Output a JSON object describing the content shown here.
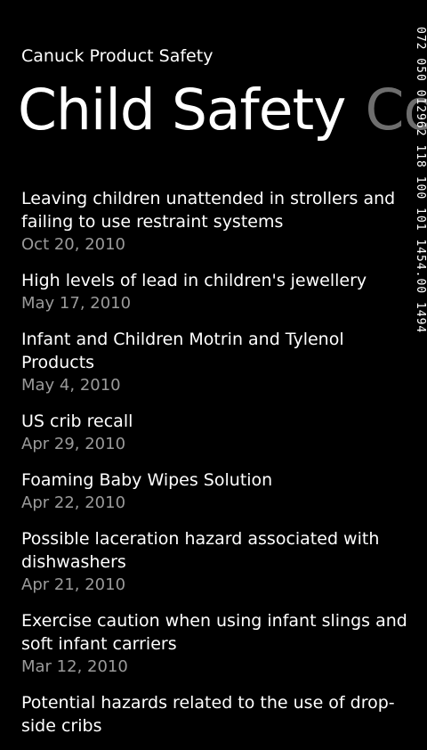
{
  "app": {
    "title": "Canuck Product Safety"
  },
  "pivot": {
    "active": "Child Safety",
    "next_peek": "Co"
  },
  "overlay_counter": "072 050 012962 118 100 101 1454.00 1494",
  "items": [
    {
      "title": "Leaving children unattended in strollers and failing to use restraint systems",
      "date": "Oct 20, 2010"
    },
    {
      "title": "High levels of lead in children's jewellery",
      "date": "May 17, 2010"
    },
    {
      "title": "Infant and Children Motrin and Tylenol Products",
      "date": "May 4, 2010"
    },
    {
      "title": "US crib recall",
      "date": "Apr 29, 2010"
    },
    {
      "title": "Foaming Baby Wipes Solution",
      "date": "Apr 22, 2010"
    },
    {
      "title": "Possible laceration hazard associated with dishwashers",
      "date": "Apr 21, 2010"
    },
    {
      "title": "Exercise caution when using infant slings and soft infant carriers",
      "date": "Mar 12, 2010"
    },
    {
      "title": "Potential hazards related to the use of drop-side cribs",
      "date": ""
    }
  ],
  "colors": {
    "background": "#000000",
    "text": "#ffffff",
    "subtle": "#9a9a9a",
    "inactive_pivot": "#6e6e6e"
  }
}
